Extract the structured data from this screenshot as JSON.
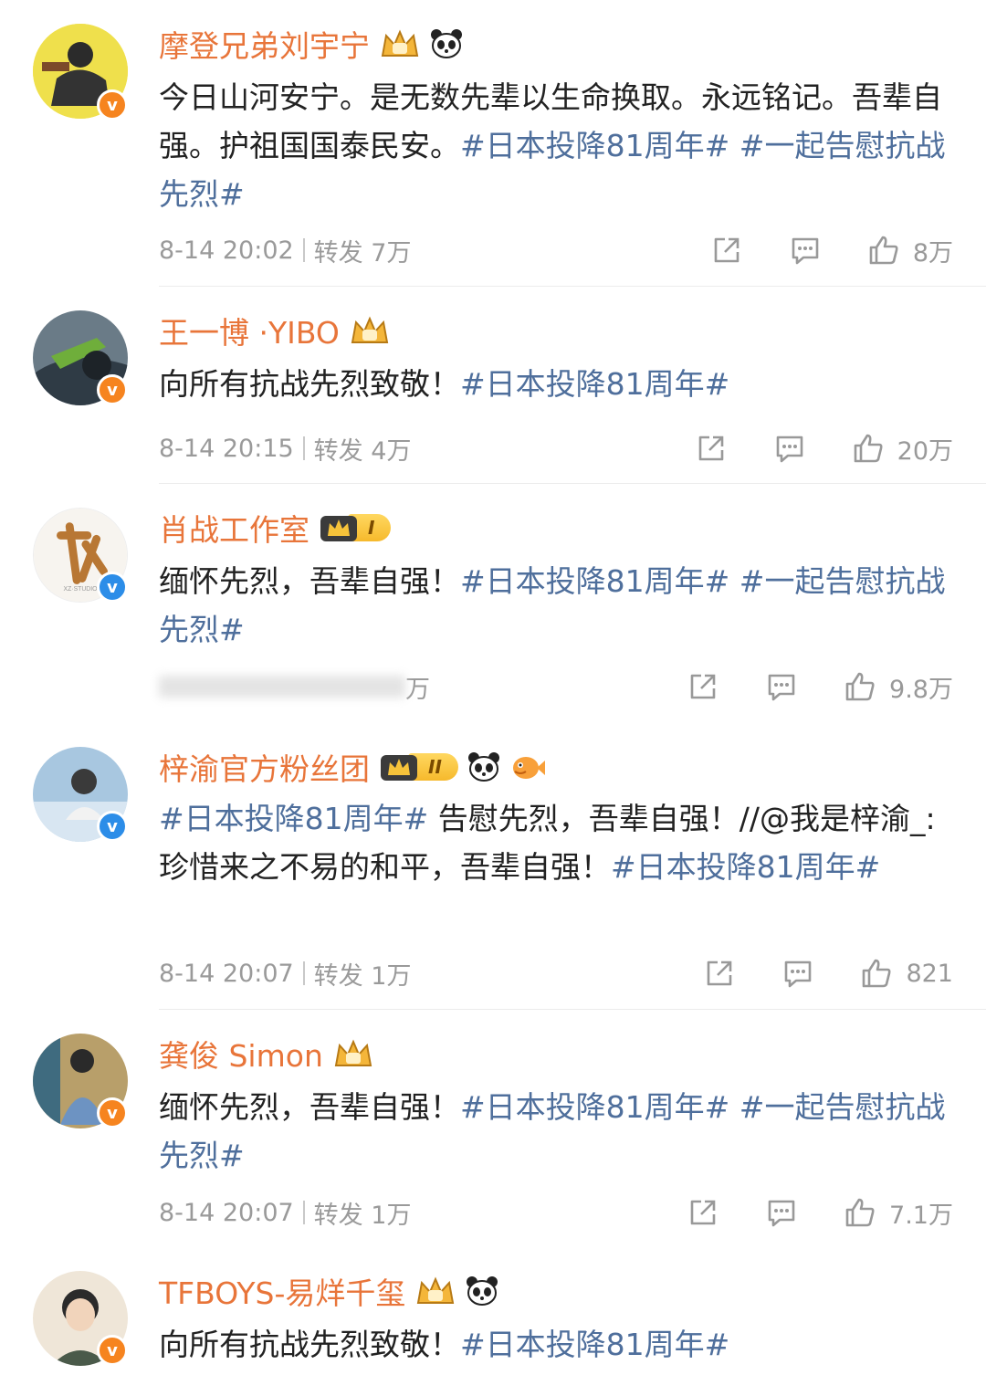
{
  "posts": [
    {
      "name": "摩登兄弟刘宇宁",
      "badges": [
        "crown-icon",
        "panda-icon"
      ],
      "verify": "orange",
      "text": [
        "今日山河安宁。是无数先辈以生命换取。永远铭记。吾辈自强。护祖国国泰民安。",
        "#日本投降81周年#",
        " ",
        "#一起告慰抗战先烈#"
      ],
      "time": "8-14 20:02",
      "repost_label": "转发",
      "repost_count": "7万",
      "like_count": "8万"
    },
    {
      "name": "王一博 ·YIBO",
      "badges": [
        "crown-icon"
      ],
      "verify": "orange",
      "text": [
        "向所有抗战先烈致敬！",
        "#日本投降81周年#"
      ],
      "time": "8-14 20:15",
      "repost_label": "转发",
      "repost_count": "4万",
      "like_count": "20万"
    },
    {
      "name": "肖战工作室",
      "badges": [
        "crown-level-icon"
      ],
      "level": "I",
      "verify": "blue",
      "text": [
        "缅怀先烈，吾辈自强！",
        "#日本投降81周年#",
        " ",
        "#一起告慰抗战先烈#"
      ],
      "time": "",
      "repost_label": "",
      "repost_count": "万",
      "like_count": "9.8万"
    },
    {
      "name": "梓渝官方粉丝团",
      "badges": [
        "crown-level-icon",
        "panda-icon",
        "fish-icon"
      ],
      "level": "II",
      "verify": "blue",
      "text": [
        "#日本投降81周年#",
        " 告慰先烈，吾辈自强！//@我是梓渝_:珍惜来之不易的和平，吾辈自强！",
        "#日本投降81周年#"
      ],
      "time": "8-14 20:07",
      "repost_label": "转发",
      "repost_count": "1万",
      "like_count": "821"
    },
    {
      "name": "龚俊 Simon",
      "badges": [
        "crown-icon"
      ],
      "verify": "orange",
      "text": [
        "缅怀先烈，吾辈自强！",
        "#日本投降81周年#",
        " ",
        "#一起告慰抗战先烈#"
      ],
      "time": "8-14 20:07",
      "repost_label": "转发",
      "repost_count": "1万",
      "like_count": "7.1万"
    },
    {
      "name": "TFBOYS-易烊千玺",
      "badges": [
        "crown-icon",
        "panda-icon"
      ],
      "verify": "orange",
      "text": [
        "向所有抗战先烈致敬！",
        "#日本投降81周年#"
      ],
      "time": "",
      "repost_label": "",
      "repost_count": "",
      "like_count": ""
    }
  ],
  "colors": {
    "name": "#e8753a",
    "hashtag": "#4f6f9c",
    "meta": "#9a9a9a",
    "verify_orange": "#f6841f",
    "verify_blue": "#2c8de8"
  }
}
